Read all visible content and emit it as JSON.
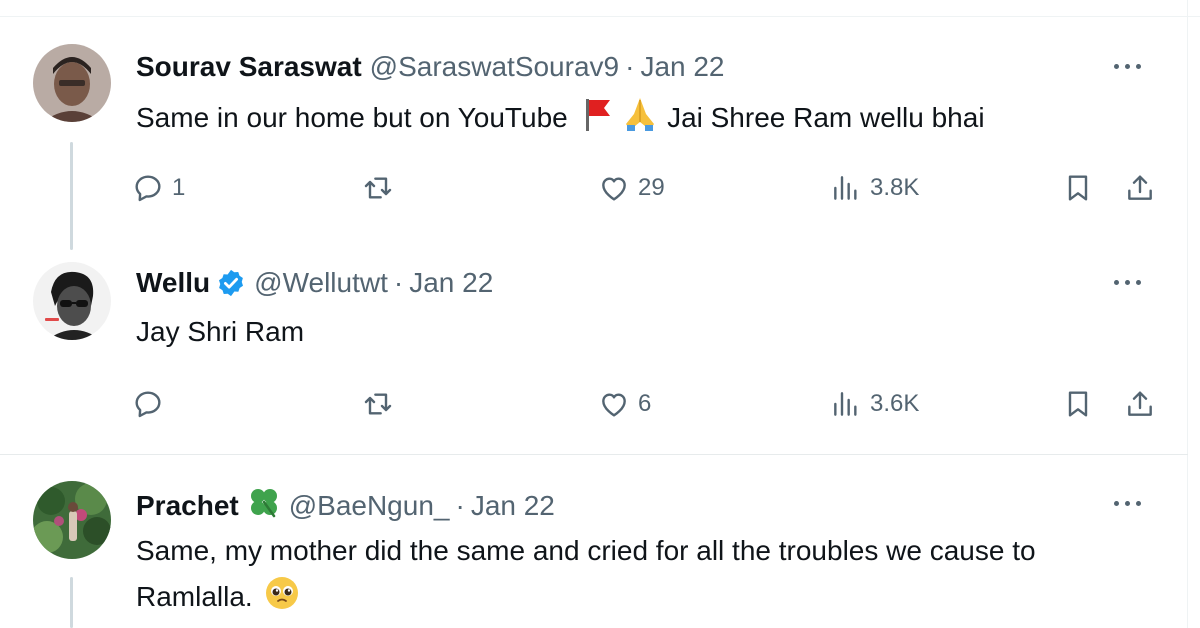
{
  "tweets": [
    {
      "name": "Sourav Saraswat",
      "handle": "@SaraswatSourav9",
      "sep": "·",
      "date": "Jan 22",
      "text_before": "Same in our home but on YouTube",
      "text_after": "Jai Shree Ram wellu bhai",
      "emojis": [
        "flag-emoji",
        "folded-hands-emoji"
      ],
      "replies": "1",
      "retweets": "",
      "likes": "29",
      "views": "3.8K"
    },
    {
      "name": "Wellu",
      "handle": "@Wellutwt",
      "sep": "·",
      "date": "Jan 22",
      "verified": true,
      "text": "Jay Shri Ram",
      "replies": "",
      "retweets": "",
      "likes": "6",
      "views": "3.6K"
    },
    {
      "name": "Prachet",
      "name_emoji": "four-leaf-clover-emoji",
      "handle": "@BaeNgun_",
      "sep": "·",
      "date": "Jan 22",
      "text_line1": "Same, my mother did the same and cried for all the troubles we cause to",
      "text_line2": "Ramlalla.",
      "emojis": [
        "pleading-face-emoji"
      ]
    }
  ],
  "colors": {
    "text": "#0f1419",
    "secondary": "#536471",
    "verified": "#1d9bf0",
    "thread_line": "#cfd9de"
  },
  "icons": [
    "reply-icon",
    "retweet-icon",
    "like-icon",
    "views-icon",
    "bookmark-icon",
    "share-icon",
    "more-icon",
    "verified-badge-icon"
  ]
}
